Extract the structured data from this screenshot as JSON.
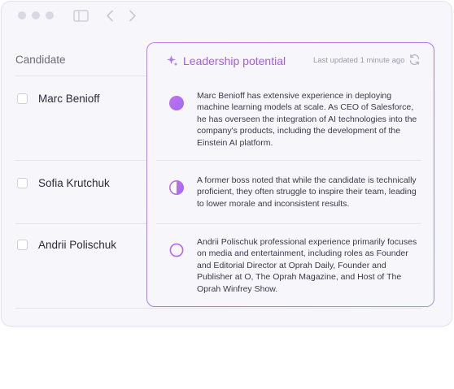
{
  "table": {
    "column_header": "Candidate",
    "rows": [
      {
        "name": "Marc Benioff",
        "rating_icon": "full-circle"
      },
      {
        "name": "Sofia Krutchuk",
        "rating_icon": "half-circle"
      },
      {
        "name": "Andrii Polischuk",
        "rating_icon": "empty-circle"
      }
    ]
  },
  "panel": {
    "title": "Leadership potential",
    "last_updated": "Last updated 1 minute ago",
    "descriptions": [
      "Marc Benioff has extensive experience in deploying machine learning models at scale. As CEO of Salesforce, he has overseen the integration of AI technologies into the company's products, including the development of the Einstein AI platform.",
      "A former boss noted that while the candidate is technically proficient, they often struggle to inspire their team, leading to lower morale and inconsistent results.",
      "Andrii Polischuk professional experience primarily focuses on media and entertainment, including roles as Founder and Editorial Director at Oprah Daily, Founder and Publisher at O, The Oprah Magazine, and Host of The Oprah Winfrey Show."
    ]
  },
  "colors": {
    "accent": "#a35be6",
    "gradient_start": "#c27cf0",
    "gradient_end": "#8f9af2"
  }
}
